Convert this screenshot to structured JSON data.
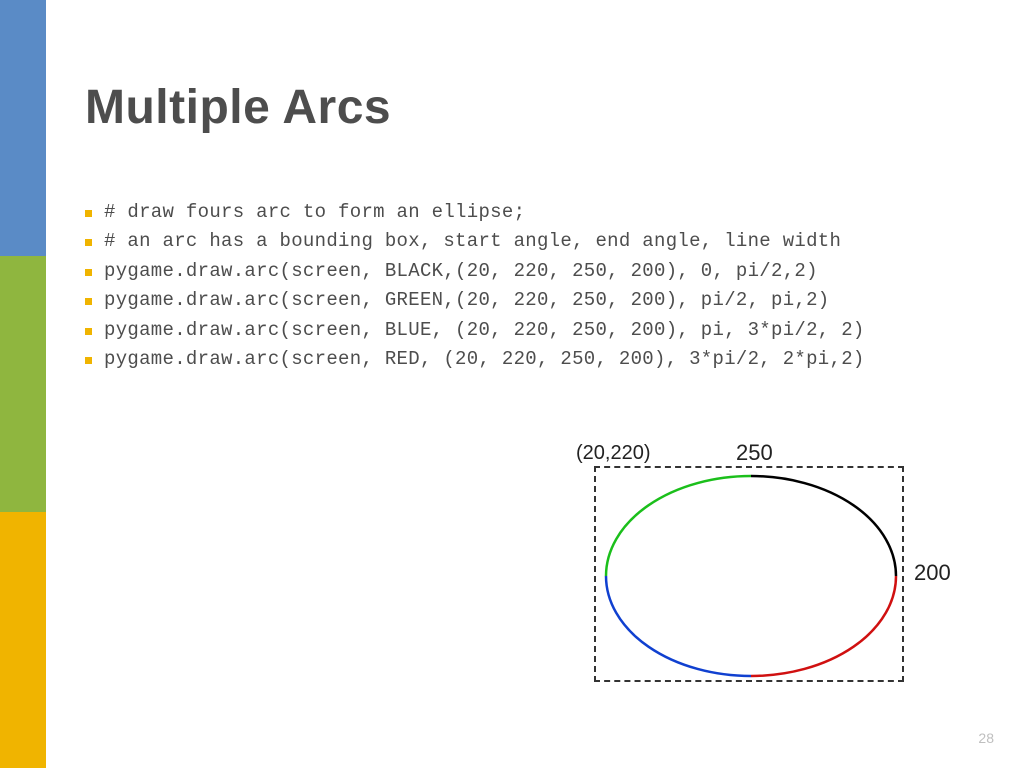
{
  "title": "Multiple Arcs",
  "bullets": [
    "# draw fours arc to form an ellipse;",
    "# an arc has a bounding box, start angle, end angle, line width",
    "pygame.draw.arc(screen, BLACK,(20, 220, 250, 200), 0, pi/2,2)",
    "pygame.draw.arc(screen, GREEN,(20, 220, 250, 200), pi/2, pi,2)",
    "pygame.draw.arc(screen, BLUE, (20, 220, 250, 200), pi, 3*pi/2, 2)",
    "pygame.draw.arc(screen, RED, (20, 220, 250, 200), 3*pi/2, 2*pi,2)"
  ],
  "diagram": {
    "origin_label": "(20,220)",
    "width_label": "250",
    "height_label": "200",
    "arcs": [
      {
        "name": "black-arc",
        "color": "#000000",
        "start_deg": 0,
        "end_deg": 90
      },
      {
        "name": "green-arc",
        "color": "#1bbf1b",
        "start_deg": 90,
        "end_deg": 180
      },
      {
        "name": "blue-arc",
        "color": "#1040d0",
        "start_deg": 180,
        "end_deg": 270
      },
      {
        "name": "red-arc",
        "color": "#d01010",
        "start_deg": 270,
        "end_deg": 360
      }
    ]
  },
  "page_number": "28"
}
